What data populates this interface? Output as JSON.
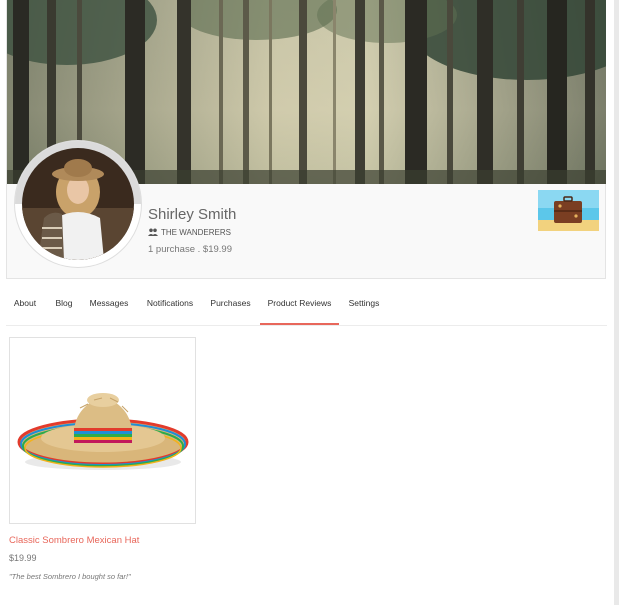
{
  "profile": {
    "name": "Shirley Smith",
    "group": "THE WANDERERS",
    "group_icon": "users-icon",
    "purchase_summary": "1 purchase . $19.99"
  },
  "tabs": [
    {
      "label": "About",
      "active": false
    },
    {
      "label": "Blog",
      "active": false
    },
    {
      "label": "Messages",
      "active": false
    },
    {
      "label": "Notifications",
      "active": false
    },
    {
      "label": "Purchases",
      "active": false
    },
    {
      "label": "Product Reviews",
      "active": true
    },
    {
      "label": "Settings",
      "active": false
    }
  ],
  "reviews": [
    {
      "product_name": "Classic Sombrero Mexican Hat",
      "price": "$19.99",
      "review": "\"The best Sombrero I bought so far!\""
    }
  ],
  "colors": {
    "accent": "#e8675b",
    "background": "#ffffff",
    "card": "#f9f9f9"
  }
}
